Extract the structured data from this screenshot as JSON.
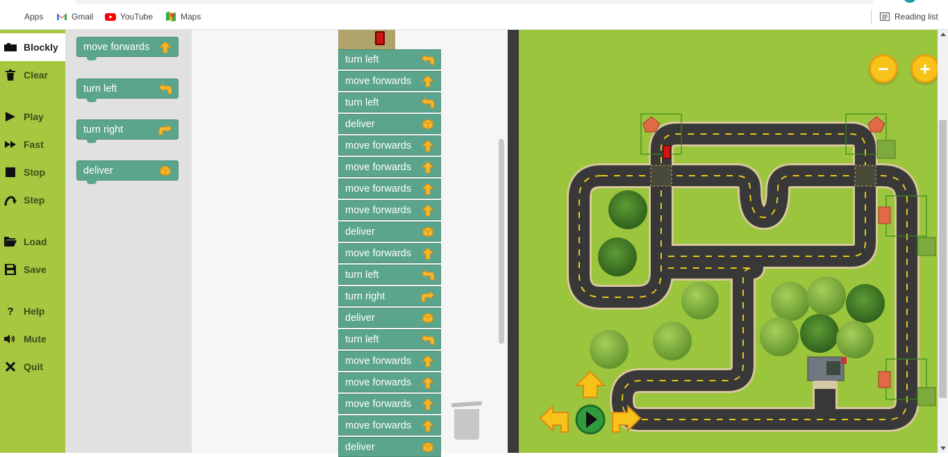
{
  "bookmarks": [
    {
      "label": "Apps",
      "icon": "apps-grid-icon"
    },
    {
      "label": "Gmail",
      "icon": "gmail-icon"
    },
    {
      "label": "YouTube",
      "icon": "youtube-icon"
    },
    {
      "label": "Maps",
      "icon": "maps-icon"
    }
  ],
  "reading_list": "Reading list",
  "toolbar": {
    "items": [
      {
        "label": "Blockly",
        "icon": "blockly-icon"
      },
      {
        "label": "Clear",
        "icon": "trash-icon"
      },
      {
        "label": "Play",
        "icon": "play-icon"
      },
      {
        "label": "Fast",
        "icon": "fast-forward-icon"
      },
      {
        "label": "Stop",
        "icon": "stop-icon"
      },
      {
        "label": "Step",
        "icon": "step-icon"
      },
      {
        "label": "Load",
        "icon": "folder-icon"
      },
      {
        "label": "Save",
        "icon": "save-icon"
      },
      {
        "label": "Help",
        "icon": "help-icon"
      },
      {
        "label": "Mute",
        "icon": "speaker-icon"
      },
      {
        "label": "Quit",
        "icon": "close-icon"
      }
    ]
  },
  "flyout": [
    {
      "label": "move forwards",
      "icon": "arrow-up-icon"
    },
    {
      "label": "turn left",
      "icon": "turn-left-icon"
    },
    {
      "label": "turn right",
      "icon": "turn-right-icon"
    },
    {
      "label": "deliver",
      "icon": "parcel-icon"
    }
  ],
  "program": [
    {
      "label": "turn left",
      "icon": "turn-left-icon"
    },
    {
      "label": "move forwards",
      "icon": "arrow-up-icon"
    },
    {
      "label": "turn left",
      "icon": "turn-left-icon"
    },
    {
      "label": "deliver",
      "icon": "parcel-icon"
    },
    {
      "label": "move forwards",
      "icon": "arrow-up-icon"
    },
    {
      "label": "move forwards",
      "icon": "arrow-up-icon"
    },
    {
      "label": "move forwards",
      "icon": "arrow-up-icon"
    },
    {
      "label": "move forwards",
      "icon": "arrow-up-icon"
    },
    {
      "label": "deliver",
      "icon": "parcel-icon"
    },
    {
      "label": "move forwards",
      "icon": "arrow-up-icon"
    },
    {
      "label": "turn left",
      "icon": "turn-left-icon"
    },
    {
      "label": "turn right",
      "icon": "turn-right-icon"
    },
    {
      "label": "deliver",
      "icon": "parcel-icon"
    },
    {
      "label": "turn left",
      "icon": "turn-left-icon"
    },
    {
      "label": "move forwards",
      "icon": "arrow-up-icon"
    },
    {
      "label": "move forwards",
      "icon": "arrow-up-icon"
    },
    {
      "label": "move forwards",
      "icon": "arrow-up-icon"
    },
    {
      "label": "move forwards",
      "icon": "arrow-up-icon"
    },
    {
      "label": "deliver",
      "icon": "parcel-icon"
    }
  ],
  "zoom": {
    "out_label": "−",
    "in_label": "+"
  },
  "colors": {
    "toolbar": "#a6c73f",
    "block": "#5ba58c",
    "grass": "#9bc53d",
    "road": "#3a3a3a",
    "accent": "#f7c21a"
  }
}
